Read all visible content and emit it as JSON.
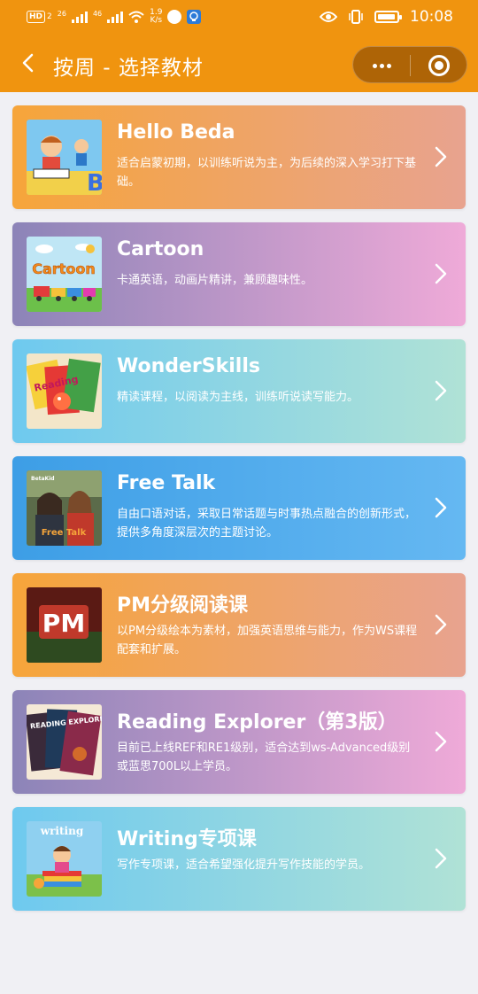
{
  "status_bar": {
    "hd": "HD",
    "sim1": "2",
    "sig1": "26",
    "sig2": "46",
    "speed_value": "1.9",
    "speed_unit": "K/s",
    "time": "10:08"
  },
  "navbar": {
    "title": "按周 - 选择教材"
  },
  "colors": {
    "header": "#f0940f",
    "background": "#f0f0f4"
  },
  "courses": [
    {
      "title": "Hello Beda",
      "desc": "适合启蒙初期，以训练听说为主，为后续的深入学习打下基础。",
      "thumb_text": "B",
      "thumb_icon": "kids-reading-icon"
    },
    {
      "title": "Cartoon",
      "desc": "卡通英语，动画片精讲，兼顾趣味性。",
      "thumb_text": "Cartoon",
      "thumb_icon": "cartoon-train-icon"
    },
    {
      "title": "WonderSkills",
      "desc": "精读课程，以阅读为主线，训练听说读写能力。",
      "thumb_text": "Reading",
      "thumb_icon": "books-icon"
    },
    {
      "title": "Free Talk",
      "desc": "自由口语对话，采取日常话题与时事热点融合的创新形式，提供多角度深层次的主题讨论。",
      "thumb_text": "Free Talk",
      "thumb_brand": "BetaKid",
      "thumb_icon": "people-talking-icon"
    },
    {
      "title": "PM分级阅读课",
      "desc": "以PM分级绘本为素材，加强英语思维与能力，作为WS课程配套和扩展。",
      "thumb_text": "PM",
      "thumb_icon": "pm-logo-icon"
    },
    {
      "title": "Reading Explorer（第3版）",
      "desc": "目前已上线REF和RE1级别，适合达到ws-Advanced级别或蓝思700L以上学员。",
      "thumb_text": "READING EXPLORER",
      "thumb_icon": "book-covers-icon"
    },
    {
      "title": "Writing专项课",
      "desc": "写作专项课，适合希望强化提升写作技能的学员。",
      "thumb_text": "writing",
      "thumb_icon": "kid-writing-icon"
    }
  ]
}
